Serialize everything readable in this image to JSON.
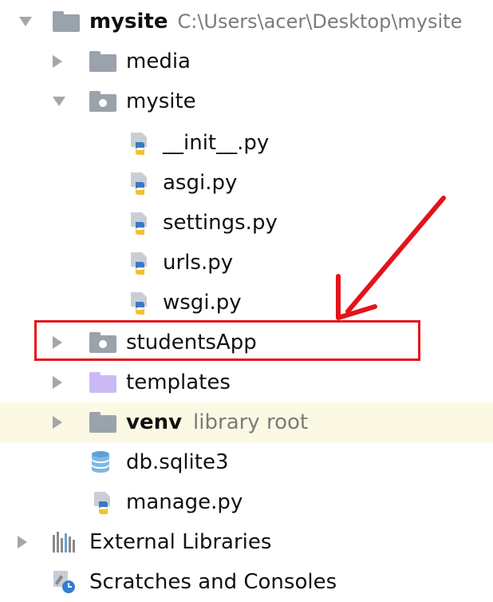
{
  "tree": {
    "root": {
      "name": "mysite",
      "path": "C:\\Users\\acer\\Desktop\\mysite"
    },
    "media": "media",
    "mysite_pkg": "mysite",
    "files": [
      "__init__.py",
      "asgi.py",
      "settings.py",
      "urls.py",
      "wsgi.py"
    ],
    "studentsApp": "studentsApp",
    "templates": "templates",
    "venv": {
      "name": "venv",
      "note": "library root"
    },
    "db": "db.sqlite3",
    "manage": "manage.py",
    "external": "External Libraries",
    "scratches": "Scratches and Consoles"
  },
  "colors": {
    "highlight_row": "#fbf9e3",
    "annotation": "#e3131a",
    "folder": "#9aa2ab",
    "templates_folder": "#cbbaf6"
  },
  "icons": {
    "expand": "chevron-right-icon",
    "collapse": "chevron-down-icon",
    "folder": "folder-icon",
    "python_file": "python-file-icon",
    "database": "database-icon",
    "libraries": "libraries-icon",
    "scratches": "scratches-icon"
  }
}
